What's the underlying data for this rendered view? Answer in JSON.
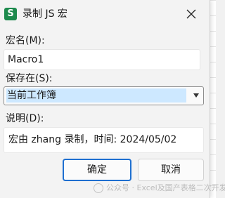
{
  "window": {
    "title": "录制 JS 宏",
    "app_icon_letter": "S",
    "icon_color": "#1d8a4d"
  },
  "fields": {
    "macro_name_label": "宏名(M):",
    "macro_name_value": "Macro1",
    "save_in_label": "保存在(S):",
    "save_in_value": "当前工作簿",
    "description_label": "说明(D):",
    "description_value": "宏由 zhang 录制，时间: 2024/05/02"
  },
  "buttons": {
    "ok_label": "确定",
    "cancel_label": "取消",
    "ok_border_color": "#1e6fd0"
  },
  "icons": {
    "app": "wps-spreadsheet-icon",
    "close": "close-icon",
    "dropdown": "chevron-down-icon"
  },
  "watermark": {
    "text": "公众号 · Excel及国产表格二次开发"
  }
}
